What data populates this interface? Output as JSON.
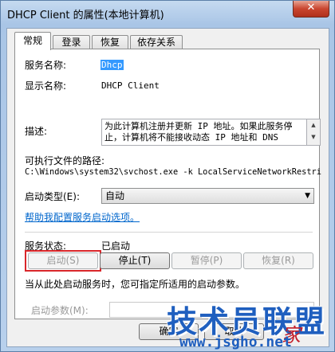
{
  "window": {
    "title": "DHCP Client 的属性(本地计算机)",
    "close_glyph": "✕"
  },
  "tabs": [
    "常规",
    "登录",
    "恢复",
    "依存关系"
  ],
  "general": {
    "service_name_label": "服务名称:",
    "service_name_value": "Dhcp",
    "display_name_label": "显示名称:",
    "display_name_value": "DHCP Client",
    "description_label": "描述:",
    "description_value": "为此计算机注册并更新 IP 地址。如果此服务停止，计算机将不能接收动态 IP 地址和 DNS",
    "exe_path_label": "可执行文件的路径:",
    "exe_path_value": "C:\\Windows\\system32\\svchost.exe -k LocalServiceNetworkRestri",
    "startup_type_label": "启动类型(E):",
    "startup_type_value": "自动",
    "help_link": "帮助我配置服务启动选项。",
    "status_label": "服务状态:",
    "status_value": "已启动",
    "buttons": {
      "start": "启动(S)",
      "stop": "停止(T)",
      "pause": "暂停(P)",
      "resume": "恢复(R)"
    },
    "hint": "当从此处启动服务时，您可指定所适用的启动参数。",
    "params_label": "启动参数(M):",
    "params_value": ""
  },
  "footer": {
    "ok": "确定",
    "cancel": "取消"
  },
  "watermark": {
    "main": "技术员联盟",
    "url": "www.jsgho.net",
    "corner": "家"
  },
  "colors": {
    "highlight_box": "#d9262a",
    "link": "#0066cc",
    "watermark": "#1f5fbf"
  }
}
